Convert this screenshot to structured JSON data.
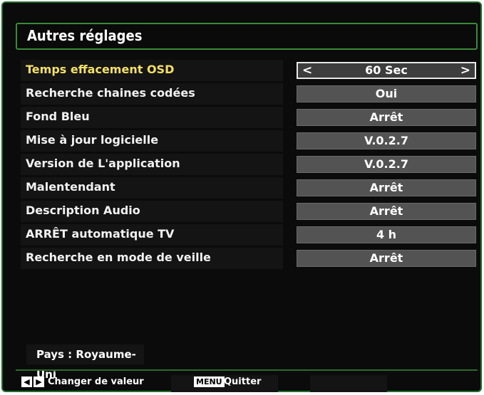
{
  "title": "Autres réglages",
  "rows": [
    {
      "label": "Temps effacement OSD",
      "value": "60 Sec",
      "selected": true
    },
    {
      "label": "Recherche chaines codées",
      "value": "Oui"
    },
    {
      "label": "Fond Bleu",
      "value": "Arrêt"
    },
    {
      "label": "Mise à jour logicielle",
      "value": "V.0.2.7"
    },
    {
      "label": "Version de L'application",
      "value": "V.0.2.7"
    },
    {
      "label": "Malentendant",
      "value": "Arrêt"
    },
    {
      "label": "Description Audio",
      "value": "Arrêt"
    },
    {
      "label": "ARRÊT automatique TV",
      "value": "4 h"
    },
    {
      "label": "Recherche en mode de veille",
      "value": "Arrêt"
    }
  ],
  "country": "Pays : Royaume-Uni",
  "footer": {
    "change_hint": "Changer de valeur",
    "menu_key": "MENU",
    "quit_hint": "Quitter",
    "left_key": "◀",
    "right_key": "▶"
  },
  "arrows": {
    "left": "<",
    "right": ">"
  },
  "colors": {
    "frame": "#1f6e2a",
    "selected_label": "#f4e064",
    "value_bg": "#535353"
  }
}
